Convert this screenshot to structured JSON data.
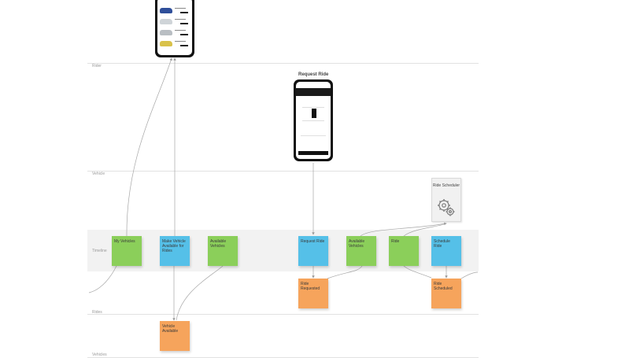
{
  "lanes": {
    "rider": "Rider",
    "vehicle": "Vehicle",
    "timeline": "Timeline",
    "rides": "Rides",
    "vehicles": "Vehicles"
  },
  "screens": {
    "request_ride_title": "Request Ride"
  },
  "stickies": {
    "my_vehicles": "My Vehicles",
    "make_vehicle_available": "Make Vehicle Available for Rides",
    "available_vehicles_1": "Available Vehicles",
    "request_ride": "Request Ride",
    "available_vehicles_2": "Available Vehicles",
    "ride": "Ride",
    "schedule_ride": "Schedule Ride",
    "ride_requested": "Ride Requested",
    "ride_scheduled": "Ride Scheduled",
    "vehicle_available": "Vehicle Available"
  },
  "scheduler": {
    "label": "Ride Scheduler",
    "icon": "gears-icon"
  },
  "colors": {
    "event": "#f6a45c",
    "command": "#55c0e8",
    "read_model": "#8bcf5a",
    "automation": "#f1f1f1"
  }
}
